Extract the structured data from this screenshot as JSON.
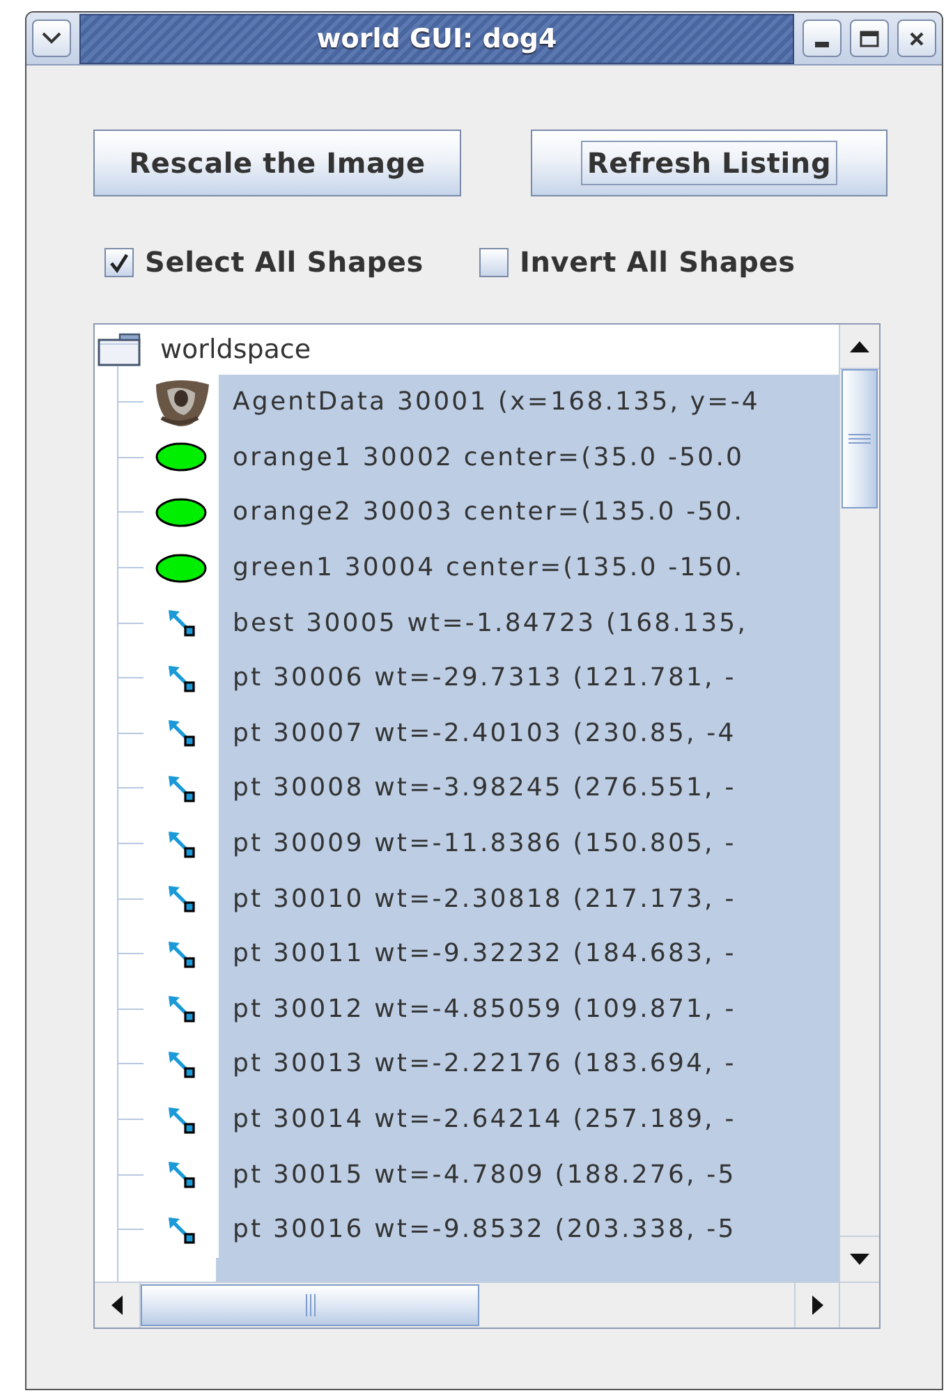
{
  "window": {
    "title": "world GUI: dog4"
  },
  "buttons": [
    {
      "label": "Rescale the Image",
      "focused": false
    },
    {
      "label": "Refresh Listing",
      "focused": true
    }
  ],
  "checkboxes": [
    {
      "label": "Select All Shapes",
      "checked": true
    },
    {
      "label": "Invert All Shapes",
      "checked": false
    }
  ],
  "tree": {
    "label": "worldspace",
    "selected": false,
    "children": [
      {
        "kind": "agent",
        "label": "AgentData 30001 (x=168.135, y=-4",
        "selected": true
      },
      {
        "kind": "ellipse",
        "label": "orange1 30002 center=(35.0 -50.0",
        "selected": true
      },
      {
        "kind": "ellipse",
        "label": "orange2 30003 center=(135.0 -50.",
        "selected": true
      },
      {
        "kind": "ellipse",
        "label": "green1 30004 center=(135.0 -150.",
        "selected": true
      },
      {
        "kind": "arrow",
        "label": "best 30005 wt=-1.84723 (168.135,",
        "selected": true
      },
      {
        "kind": "arrow",
        "label": "pt 30006 wt=-29.7313 (121.781, -",
        "selected": true
      },
      {
        "kind": "arrow",
        "label": "pt 30007 wt=-2.40103 (230.85, -4",
        "selected": true
      },
      {
        "kind": "arrow",
        "label": "pt 30008 wt=-3.98245 (276.551, -",
        "selected": true
      },
      {
        "kind": "arrow",
        "label": "pt 30009 wt=-11.8386 (150.805, -",
        "selected": true
      },
      {
        "kind": "arrow",
        "label": "pt 30010 wt=-2.30818 (217.173, -",
        "selected": true
      },
      {
        "kind": "arrow",
        "label": "pt 30011 wt=-9.32232 (184.683, -",
        "selected": true
      },
      {
        "kind": "arrow",
        "label": "pt 30012 wt=-4.85059 (109.871, -",
        "selected": true
      },
      {
        "kind": "arrow",
        "label": "pt 30013 wt=-2.22176 (183.694, -",
        "selected": true
      },
      {
        "kind": "arrow",
        "label": "pt 30014 wt=-2.64214 (257.189, -",
        "selected": true
      },
      {
        "kind": "arrow",
        "label": "pt 30015 wt=-4.7809 (188.276, -5",
        "selected": true
      },
      {
        "kind": "arrow",
        "label": "pt 30016 wt=-9.8532 (203.338, -5",
        "selected": true
      }
    ]
  }
}
